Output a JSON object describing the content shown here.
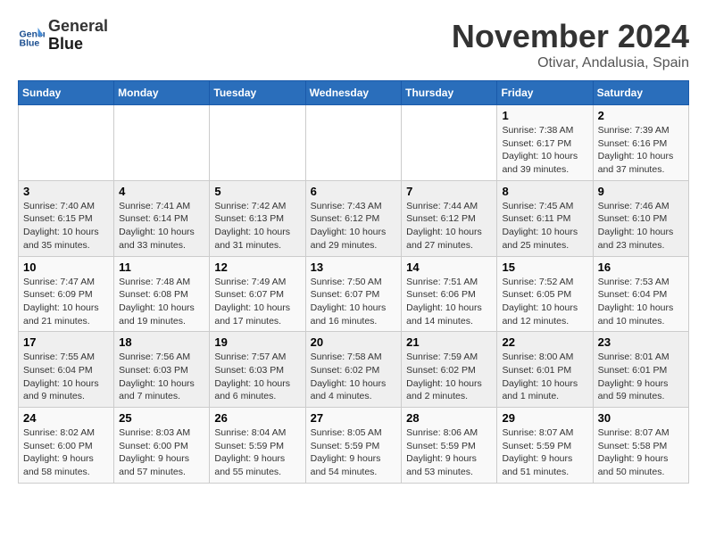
{
  "header": {
    "logo_line1": "General",
    "logo_line2": "Blue",
    "month": "November 2024",
    "location": "Otivar, Andalusia, Spain"
  },
  "weekdays": [
    "Sunday",
    "Monday",
    "Tuesday",
    "Wednesday",
    "Thursday",
    "Friday",
    "Saturday"
  ],
  "weeks": [
    [
      {
        "day": "",
        "info": ""
      },
      {
        "day": "",
        "info": ""
      },
      {
        "day": "",
        "info": ""
      },
      {
        "day": "",
        "info": ""
      },
      {
        "day": "",
        "info": ""
      },
      {
        "day": "1",
        "info": "Sunrise: 7:38 AM\nSunset: 6:17 PM\nDaylight: 10 hours and 39 minutes."
      },
      {
        "day": "2",
        "info": "Sunrise: 7:39 AM\nSunset: 6:16 PM\nDaylight: 10 hours and 37 minutes."
      }
    ],
    [
      {
        "day": "3",
        "info": "Sunrise: 7:40 AM\nSunset: 6:15 PM\nDaylight: 10 hours and 35 minutes."
      },
      {
        "day": "4",
        "info": "Sunrise: 7:41 AM\nSunset: 6:14 PM\nDaylight: 10 hours and 33 minutes."
      },
      {
        "day": "5",
        "info": "Sunrise: 7:42 AM\nSunset: 6:13 PM\nDaylight: 10 hours and 31 minutes."
      },
      {
        "day": "6",
        "info": "Sunrise: 7:43 AM\nSunset: 6:12 PM\nDaylight: 10 hours and 29 minutes."
      },
      {
        "day": "7",
        "info": "Sunrise: 7:44 AM\nSunset: 6:12 PM\nDaylight: 10 hours and 27 minutes."
      },
      {
        "day": "8",
        "info": "Sunrise: 7:45 AM\nSunset: 6:11 PM\nDaylight: 10 hours and 25 minutes."
      },
      {
        "day": "9",
        "info": "Sunrise: 7:46 AM\nSunset: 6:10 PM\nDaylight: 10 hours and 23 minutes."
      }
    ],
    [
      {
        "day": "10",
        "info": "Sunrise: 7:47 AM\nSunset: 6:09 PM\nDaylight: 10 hours and 21 minutes."
      },
      {
        "day": "11",
        "info": "Sunrise: 7:48 AM\nSunset: 6:08 PM\nDaylight: 10 hours and 19 minutes."
      },
      {
        "day": "12",
        "info": "Sunrise: 7:49 AM\nSunset: 6:07 PM\nDaylight: 10 hours and 17 minutes."
      },
      {
        "day": "13",
        "info": "Sunrise: 7:50 AM\nSunset: 6:07 PM\nDaylight: 10 hours and 16 minutes."
      },
      {
        "day": "14",
        "info": "Sunrise: 7:51 AM\nSunset: 6:06 PM\nDaylight: 10 hours and 14 minutes."
      },
      {
        "day": "15",
        "info": "Sunrise: 7:52 AM\nSunset: 6:05 PM\nDaylight: 10 hours and 12 minutes."
      },
      {
        "day": "16",
        "info": "Sunrise: 7:53 AM\nSunset: 6:04 PM\nDaylight: 10 hours and 10 minutes."
      }
    ],
    [
      {
        "day": "17",
        "info": "Sunrise: 7:55 AM\nSunset: 6:04 PM\nDaylight: 10 hours and 9 minutes."
      },
      {
        "day": "18",
        "info": "Sunrise: 7:56 AM\nSunset: 6:03 PM\nDaylight: 10 hours and 7 minutes."
      },
      {
        "day": "19",
        "info": "Sunrise: 7:57 AM\nSunset: 6:03 PM\nDaylight: 10 hours and 6 minutes."
      },
      {
        "day": "20",
        "info": "Sunrise: 7:58 AM\nSunset: 6:02 PM\nDaylight: 10 hours and 4 minutes."
      },
      {
        "day": "21",
        "info": "Sunrise: 7:59 AM\nSunset: 6:02 PM\nDaylight: 10 hours and 2 minutes."
      },
      {
        "day": "22",
        "info": "Sunrise: 8:00 AM\nSunset: 6:01 PM\nDaylight: 10 hours and 1 minute."
      },
      {
        "day": "23",
        "info": "Sunrise: 8:01 AM\nSunset: 6:01 PM\nDaylight: 9 hours and 59 minutes."
      }
    ],
    [
      {
        "day": "24",
        "info": "Sunrise: 8:02 AM\nSunset: 6:00 PM\nDaylight: 9 hours and 58 minutes."
      },
      {
        "day": "25",
        "info": "Sunrise: 8:03 AM\nSunset: 6:00 PM\nDaylight: 9 hours and 57 minutes."
      },
      {
        "day": "26",
        "info": "Sunrise: 8:04 AM\nSunset: 5:59 PM\nDaylight: 9 hours and 55 minutes."
      },
      {
        "day": "27",
        "info": "Sunrise: 8:05 AM\nSunset: 5:59 PM\nDaylight: 9 hours and 54 minutes."
      },
      {
        "day": "28",
        "info": "Sunrise: 8:06 AM\nSunset: 5:59 PM\nDaylight: 9 hours and 53 minutes."
      },
      {
        "day": "29",
        "info": "Sunrise: 8:07 AM\nSunset: 5:59 PM\nDaylight: 9 hours and 51 minutes."
      },
      {
        "day": "30",
        "info": "Sunrise: 8:07 AM\nSunset: 5:58 PM\nDaylight: 9 hours and 50 minutes."
      }
    ]
  ]
}
